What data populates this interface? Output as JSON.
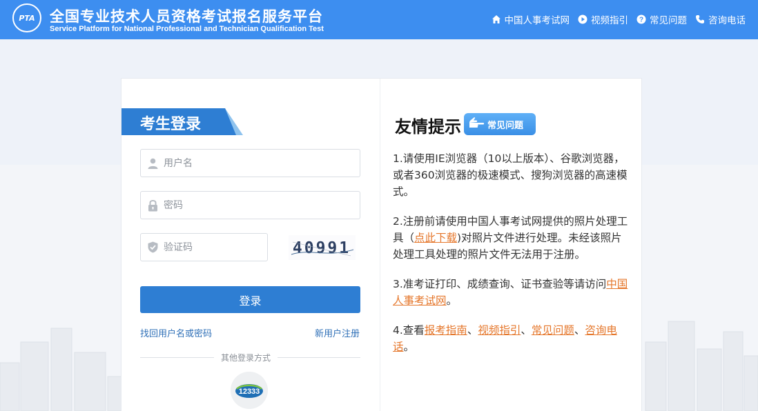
{
  "header": {
    "logo_text": "PTA",
    "title_cn": "全国专业技术人员资格考试报名服务平台",
    "title_en": "Service Platform for National Professional and Technician Qualification Test",
    "nav": [
      {
        "label": "中国人事考试网",
        "icon": "home-icon"
      },
      {
        "label": "视频指引",
        "icon": "play-icon"
      },
      {
        "label": "常见问题",
        "icon": "question-icon"
      },
      {
        "label": "咨询电话",
        "icon": "phone-icon"
      }
    ]
  },
  "login": {
    "tag": "考生登录",
    "username_placeholder": "用户名",
    "password_placeholder": "密码",
    "captcha_placeholder": "验证码",
    "captcha_text": "40991",
    "submit": "登录",
    "recover": "找回用户名或密码",
    "register": "新用户注册",
    "other": "其他登录方式",
    "alt_login_text": "12333"
  },
  "tips": {
    "title": "友情提示",
    "faq_button": "常见问题",
    "tip1": "1.请使用IE浏览器（10以上版本）、谷歌浏览器，或者360浏览器的极速模式、搜狗浏览器的高速模式。",
    "tip2_prefix": "2.注册前请使用中国人事考试网提供的照片处理工具（",
    "tip2_link": "点此下载",
    "tip2_suffix": ")对照片文件进行处理。未经该照片处理工具处理的照片文件无法用于注册。",
    "tip3_prefix": "3.准考证打印、成绩查询、证书查验等请访问",
    "tip3_link": "中国人事考试网",
    "tip3_suffix": "。",
    "tip4_prefix": "4.查看",
    "tip4_link1": "报考指南",
    "tip4_sep1": "、",
    "tip4_link2": "视频指引",
    "tip4_sep2": "、",
    "tip4_link3": "常见问题",
    "tip4_sep3": "、",
    "tip4_link4": "咨询电话",
    "tip4_suffix": "。"
  },
  "colors": {
    "header": "#3d8ef0",
    "primary": "#2e7ed3",
    "link_orange": "#e5762a"
  }
}
